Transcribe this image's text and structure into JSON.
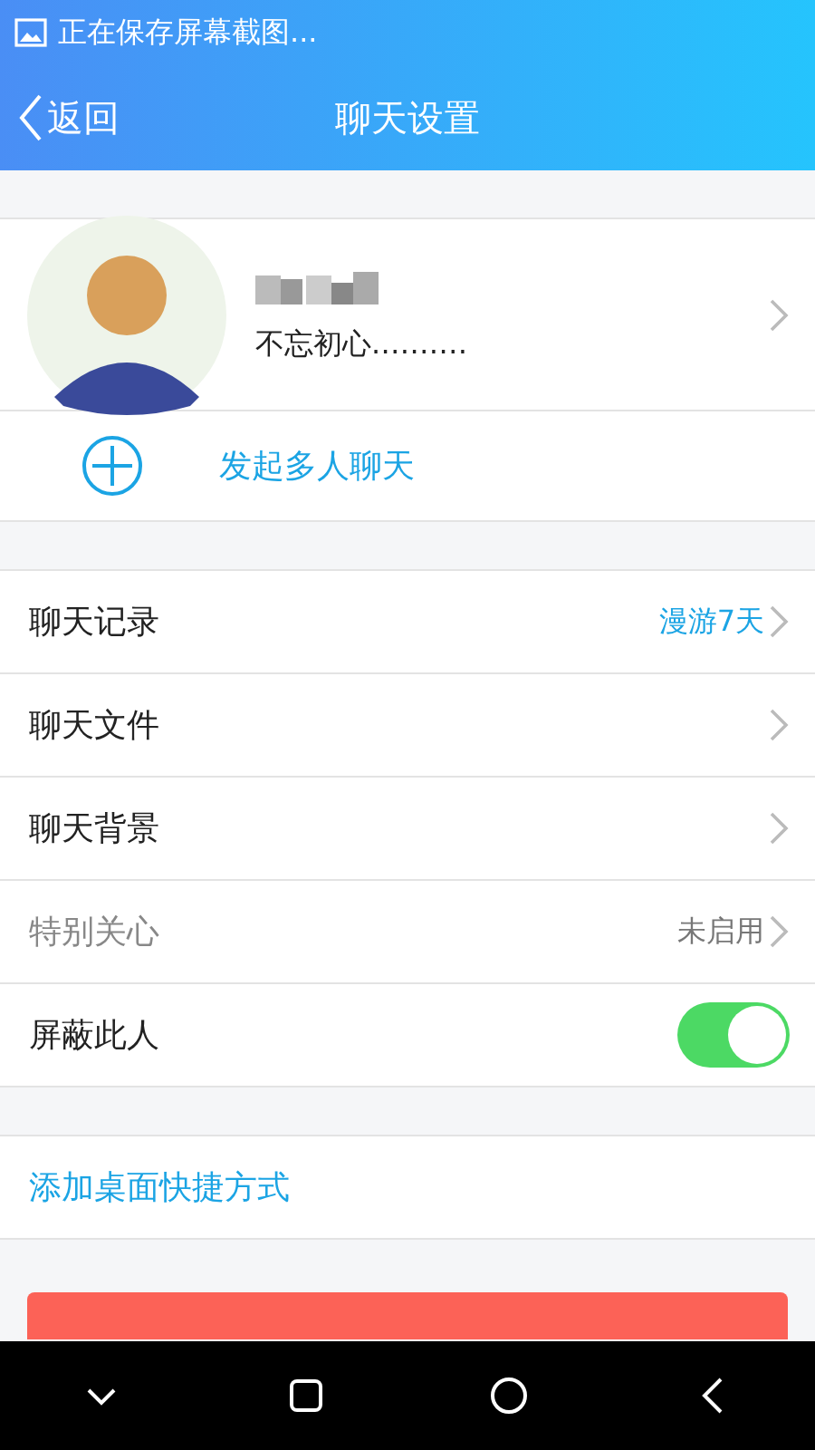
{
  "status_bar": {
    "notification": "正在保存屏幕截图..."
  },
  "header": {
    "back": "返回",
    "title": "聊天设置"
  },
  "profile": {
    "signature": "不忘初心.………"
  },
  "group_chat": {
    "label": "发起多人聊天"
  },
  "settings": [
    {
      "kind": "link",
      "label": "聊天记录",
      "value": "漫游7天",
      "disabled": false
    },
    {
      "kind": "link",
      "label": "聊天文件",
      "disabled": false
    },
    {
      "kind": "link",
      "label": "聊天背景",
      "disabled": false
    },
    {
      "kind": "link",
      "label": "特别关心",
      "value": "未启用",
      "disabled": true
    },
    {
      "kind": "toggle",
      "label": "屏蔽此人",
      "on": true,
      "disabled": false
    }
  ],
  "shortcut": {
    "label": "添加桌面快捷方式"
  }
}
